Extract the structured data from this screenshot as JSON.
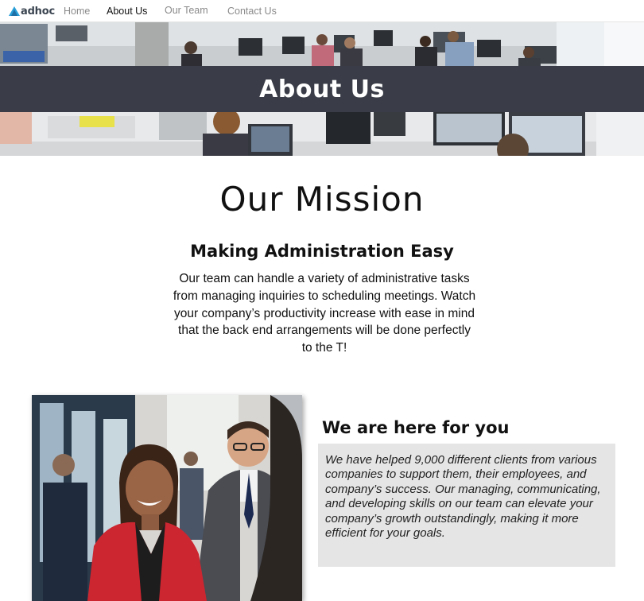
{
  "nav": {
    "logo_text": "adhoc",
    "links": [
      {
        "label": "Home",
        "active": false
      },
      {
        "label": "About Us",
        "active": true
      },
      {
        "label": "Our Team",
        "active": false
      },
      {
        "label": "Contact Us",
        "active": false
      }
    ]
  },
  "hero": {
    "title": "About Us",
    "band_color": "#3a3d47"
  },
  "mission": {
    "title": "Our Mission",
    "subtitle": "Making Administration Easy",
    "text": "Our team can handle a variety of administrative tasks from managing inquiries to scheduling meetings. Watch your company’s productivity increase with ease in mind that the back end arrangements will be done perfectly to the T!"
  },
  "support": {
    "title": "We are here for you",
    "text": "We have helped 9,000 different clients from various companies to support them, their employees, and company’s success. Our managing, communicating, and developing skills on our team can elevate your company’s growth outstandingly, making it more efficient for your goals."
  },
  "colors": {
    "logo_accent": "#2a9fd8",
    "box_background": "#e5e5e5"
  }
}
